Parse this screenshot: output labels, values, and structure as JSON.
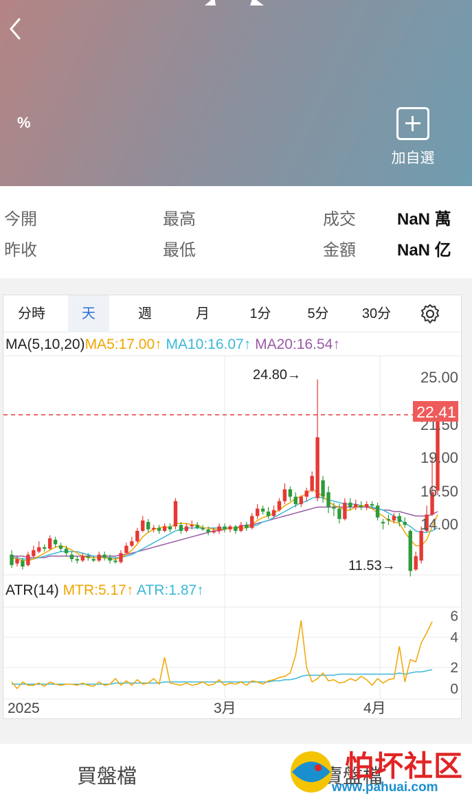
{
  "header": {
    "percent": "%",
    "add_watchlist_label": "加自選"
  },
  "stats": {
    "open_label": "今開",
    "prev_close_label": "昨收",
    "high_label": "最高",
    "low_label": "最低",
    "volume_label": "成交",
    "volume_value": "NaN 萬",
    "amount_label": "金額",
    "amount_value": "NaN 亿"
  },
  "tabs": [
    "分時",
    "天",
    "週",
    "月",
    "1分",
    "5分",
    "30分"
  ],
  "active_tab": "天",
  "indicators": {
    "ma_title": "MA(5,10,20)",
    "ma5": "MA5:17.00↑",
    "ma10": "MA10:16.07↑",
    "ma20": "MA20:16.54↑",
    "atr_title": "ATR(14)",
    "mtr": "MTR:5.17↑",
    "atr": "ATR:1.87↑"
  },
  "colors": {
    "up": "#e53935",
    "down": "#2e9b3a",
    "ma5": "#f0a500",
    "ma10": "#3bb8d8",
    "ma20": "#9b5aa6",
    "accent": "#2b6fd6"
  },
  "chart_data": {
    "type": "candlestick",
    "price_axis_labels": [
      "25.00",
      "21.50",
      "19.00",
      "16.50",
      "14.00"
    ],
    "last_price": "22.41",
    "high_annotation": "24.80→",
    "low_annotation": "11.53→",
    "x_labels": [
      "2025",
      "3月",
      "4月"
    ],
    "atr_axis_labels": [
      "6",
      "4",
      "2",
      "0"
    ],
    "candles": [
      {
        "o": 13.0,
        "c": 12.3,
        "h": 13.3,
        "l": 12.1
      },
      {
        "o": 12.4,
        "c": 12.7,
        "h": 12.9,
        "l": 12.2
      },
      {
        "o": 12.6,
        "c": 12.2,
        "h": 12.8,
        "l": 12.0
      },
      {
        "o": 12.3,
        "c": 13.0,
        "h": 13.2,
        "l": 12.2
      },
      {
        "o": 12.9,
        "c": 13.3,
        "h": 13.6,
        "l": 12.8
      },
      {
        "o": 13.2,
        "c": 13.5,
        "h": 13.9,
        "l": 13.1
      },
      {
        "o": 13.5,
        "c": 13.4,
        "h": 13.7,
        "l": 13.2
      },
      {
        "o": 13.4,
        "c": 14.1,
        "h": 14.3,
        "l": 13.3
      },
      {
        "o": 14.0,
        "c": 13.7,
        "h": 14.2,
        "l": 13.5
      },
      {
        "o": 13.6,
        "c": 13.4,
        "h": 13.8,
        "l": 13.2
      },
      {
        "o": 13.4,
        "c": 13.1,
        "h": 13.6,
        "l": 12.9
      },
      {
        "o": 13.0,
        "c": 12.7,
        "h": 13.2,
        "l": 12.5
      },
      {
        "o": 12.7,
        "c": 12.6,
        "h": 12.9,
        "l": 12.4
      },
      {
        "o": 12.6,
        "c": 12.9,
        "h": 13.1,
        "l": 12.5
      },
      {
        "o": 12.9,
        "c": 12.8,
        "h": 13.1,
        "l": 12.6
      },
      {
        "o": 12.7,
        "c": 12.6,
        "h": 12.9,
        "l": 12.5
      },
      {
        "o": 12.6,
        "c": 13.0,
        "h": 13.2,
        "l": 12.5
      },
      {
        "o": 13.0,
        "c": 12.8,
        "h": 13.2,
        "l": 12.6
      },
      {
        "o": 12.8,
        "c": 12.6,
        "h": 13.0,
        "l": 12.4
      },
      {
        "o": 12.6,
        "c": 12.5,
        "h": 12.8,
        "l": 12.4
      },
      {
        "o": 12.5,
        "c": 13.1,
        "h": 13.3,
        "l": 12.4
      },
      {
        "o": 13.1,
        "c": 13.6,
        "h": 13.8,
        "l": 13.0
      },
      {
        "o": 13.6,
        "c": 13.9,
        "h": 14.2,
        "l": 13.5
      },
      {
        "o": 13.9,
        "c": 14.6,
        "h": 14.8,
        "l": 13.8
      },
      {
        "o": 14.6,
        "c": 15.3,
        "h": 15.6,
        "l": 14.5
      },
      {
        "o": 15.2,
        "c": 14.7,
        "h": 15.4,
        "l": 14.5
      },
      {
        "o": 14.7,
        "c": 14.8,
        "h": 15.0,
        "l": 14.5
      },
      {
        "o": 14.8,
        "c": 14.6,
        "h": 15.0,
        "l": 14.4
      },
      {
        "o": 14.6,
        "c": 14.9,
        "h": 15.1,
        "l": 14.5
      },
      {
        "o": 14.9,
        "c": 14.7,
        "h": 15.1,
        "l": 14.5
      },
      {
        "o": 14.9,
        "c": 16.6,
        "h": 16.8,
        "l": 14.7
      },
      {
        "o": 15.0,
        "c": 14.6,
        "h": 15.2,
        "l": 14.4
      },
      {
        "o": 14.6,
        "c": 14.9,
        "h": 15.1,
        "l": 14.5
      },
      {
        "o": 14.9,
        "c": 15.0,
        "h": 15.3,
        "l": 14.7
      },
      {
        "o": 15.0,
        "c": 14.8,
        "h": 15.2,
        "l": 14.7
      },
      {
        "o": 14.8,
        "c": 14.7,
        "h": 15.0,
        "l": 14.6
      },
      {
        "o": 14.7,
        "c": 14.5,
        "h": 14.9,
        "l": 14.3
      },
      {
        "o": 14.5,
        "c": 14.6,
        "h": 14.8,
        "l": 14.4
      },
      {
        "o": 14.6,
        "c": 14.9,
        "h": 15.1,
        "l": 14.4
      },
      {
        "o": 14.9,
        "c": 14.7,
        "h": 15.1,
        "l": 14.5
      },
      {
        "o": 14.7,
        "c": 14.9,
        "h": 15.0,
        "l": 14.5
      },
      {
        "o": 14.9,
        "c": 14.6,
        "h": 15.0,
        "l": 14.4
      },
      {
        "o": 14.6,
        "c": 15.0,
        "h": 15.2,
        "l": 14.5
      },
      {
        "o": 15.0,
        "c": 14.8,
        "h": 15.2,
        "l": 14.6
      },
      {
        "o": 14.8,
        "c": 15.6,
        "h": 15.8,
        "l": 14.7
      },
      {
        "o": 15.6,
        "c": 16.1,
        "h": 16.4,
        "l": 15.4
      },
      {
        "o": 16.1,
        "c": 15.9,
        "h": 16.3,
        "l": 15.7
      },
      {
        "o": 15.9,
        "c": 15.6,
        "h": 16.2,
        "l": 15.4
      },
      {
        "o": 15.6,
        "c": 16.0,
        "h": 16.3,
        "l": 15.5
      },
      {
        "o": 16.0,
        "c": 16.6,
        "h": 16.8,
        "l": 15.9
      },
      {
        "o": 16.6,
        "c": 17.4,
        "h": 17.8,
        "l": 16.4
      },
      {
        "o": 17.4,
        "c": 16.9,
        "h": 17.6,
        "l": 16.6
      },
      {
        "o": 16.9,
        "c": 16.4,
        "h": 17.2,
        "l": 16.2
      },
      {
        "o": 16.4,
        "c": 16.9,
        "h": 17.0,
        "l": 16.2
      },
      {
        "o": 16.9,
        "c": 17.3,
        "h": 17.5,
        "l": 16.6
      },
      {
        "o": 17.3,
        "c": 18.3,
        "h": 18.6,
        "l": 17.2
      },
      {
        "o": 16.8,
        "c": 20.9,
        "h": 24.8,
        "l": 16.6
      },
      {
        "o": 18.0,
        "c": 16.9,
        "h": 18.3,
        "l": 16.5
      },
      {
        "o": 17.2,
        "c": 16.2,
        "h": 17.6,
        "l": 15.8
      },
      {
        "o": 16.2,
        "c": 16.1,
        "h": 16.5,
        "l": 15.6
      },
      {
        "o": 16.1,
        "c": 15.4,
        "h": 16.4,
        "l": 15.1
      },
      {
        "o": 15.4,
        "c": 16.5,
        "h": 16.8,
        "l": 15.3
      },
      {
        "o": 16.5,
        "c": 16.2,
        "h": 16.8,
        "l": 16.0
      },
      {
        "o": 16.2,
        "c": 16.4,
        "h": 16.7,
        "l": 16.0
      },
      {
        "o": 16.3,
        "c": 16.2,
        "h": 16.6,
        "l": 16.0
      },
      {
        "o": 16.2,
        "c": 16.4,
        "h": 16.6,
        "l": 16.0
      },
      {
        "o": 16.4,
        "c": 16.3,
        "h": 16.6,
        "l": 16.1
      },
      {
        "o": 16.3,
        "c": 15.5,
        "h": 16.5,
        "l": 15.3
      },
      {
        "o": 15.2,
        "c": 15.1,
        "h": 15.4,
        "l": 14.7
      },
      {
        "o": 15.4,
        "c": 15.3,
        "h": 15.7,
        "l": 15.0
      },
      {
        "o": 15.3,
        "c": 15.6,
        "h": 15.8,
        "l": 15.1
      },
      {
        "o": 15.6,
        "c": 15.2,
        "h": 15.8,
        "l": 14.9
      },
      {
        "o": 15.2,
        "c": 15.0,
        "h": 15.5,
        "l": 14.8
      },
      {
        "o": 14.6,
        "c": 11.9,
        "h": 14.7,
        "l": 11.53
      },
      {
        "o": 12.0,
        "c": 12.9,
        "h": 13.2,
        "l": 11.9
      },
      {
        "o": 12.6,
        "c": 14.6,
        "h": 14.9,
        "l": 12.4
      },
      {
        "o": 14.6,
        "c": 15.7,
        "h": 16.3,
        "l": 14.5
      },
      {
        "o": 15.7,
        "c": 17.2,
        "h": 19.6,
        "l": 15.6
      },
      {
        "o": 17.3,
        "c": 22.41,
        "h": 22.5,
        "l": 17.0
      }
    ],
    "ma5": [
      12.8,
      12.7,
      12.6,
      12.6,
      12.7,
      12.9,
      13.1,
      13.3,
      13.5,
      13.6,
      13.5,
      13.3,
      13.1,
      12.9,
      12.8,
      12.8,
      12.8,
      12.8,
      12.7,
      12.7,
      12.8,
      13.0,
      13.3,
      13.7,
      14.2,
      14.5,
      14.7,
      14.8,
      14.9,
      14.8,
      15.1,
      15.1,
      15.1,
      15.0,
      15.0,
      14.8,
      14.8,
      14.7,
      14.7,
      14.7,
      14.8,
      14.8,
      14.8,
      14.8,
      15.0,
      15.3,
      15.5,
      15.6,
      15.8,
      16.0,
      16.3,
      16.5,
      16.8,
      16.9,
      17.1,
      17.4,
      17.2,
      16.9,
      16.6,
      16.3,
      16.2,
      16.0,
      16.0,
      16.2,
      16.3,
      16.3,
      16.1,
      15.8,
      15.6,
      15.3,
      15.2,
      15.1,
      14.5,
      14.0,
      13.6,
      13.6,
      14.0,
      14.9,
      15.7
    ],
    "ma10": [
      12.8,
      12.8,
      12.7,
      12.7,
      12.7,
      12.8,
      12.9,
      13.0,
      13.1,
      13.2,
      13.2,
      13.2,
      13.2,
      13.1,
      13.0,
      12.9,
      12.9,
      12.8,
      12.8,
      12.8,
      12.8,
      12.9,
      13.0,
      13.2,
      13.4,
      13.6,
      13.8,
      14.0,
      14.2,
      14.4,
      14.6,
      14.7,
      14.8,
      14.8,
      14.8,
      14.8,
      14.8,
      14.8,
      14.8,
      14.8,
      14.8,
      14.8,
      14.8,
      14.8,
      14.9,
      15.0,
      15.2,
      15.3,
      15.5,
      15.7,
      15.9,
      16.1,
      16.3,
      16.5,
      16.6,
      16.8,
      16.9,
      16.8,
      16.7,
      16.6,
      16.5,
      16.4,
      16.4,
      16.4,
      16.3,
      16.3,
      16.2,
      16.1,
      16.0,
      15.8,
      15.6,
      15.4,
      15.1,
      14.9,
      14.6,
      14.5,
      14.5,
      14.6,
      14.8
    ],
    "ma20": [
      12.9,
      12.9,
      12.9,
      12.8,
      12.8,
      12.8,
      12.8,
      12.9,
      12.9,
      12.9,
      12.9,
      12.9,
      12.9,
      12.9,
      12.9,
      12.9,
      12.9,
      12.9,
      12.9,
      12.9,
      13.0,
      13.0,
      13.1,
      13.2,
      13.3,
      13.4,
      13.5,
      13.6,
      13.7,
      13.8,
      13.9,
      14.0,
      14.1,
      14.2,
      14.3,
      14.4,
      14.5,
      14.6,
      14.6,
      14.7,
      14.8,
      14.8,
      14.9,
      15.0,
      15.0,
      15.1,
      15.2,
      15.3,
      15.4,
      15.5,
      15.6,
      15.7,
      15.8,
      15.9,
      16.0,
      16.1,
      16.2,
      16.2,
      16.2,
      16.2,
      16.2,
      16.2,
      16.2,
      16.2,
      16.2,
      16.2,
      16.1,
      16.1,
      16.0,
      16.0,
      15.9,
      15.9,
      15.8,
      15.7,
      15.6,
      15.6,
      15.6,
      15.7,
      15.9
    ],
    "mtr": [
      0.8,
      0.2,
      0.8,
      0.5,
      0.5,
      0.7,
      0.4,
      0.8,
      0.6,
      0.5,
      0.6,
      0.6,
      0.5,
      0.7,
      0.5,
      0.4,
      0.8,
      0.5,
      0.6,
      1.1,
      0.5,
      0.9,
      0.5,
      1.0,
      0.6,
      0.7,
      1.1,
      0.6,
      3.0,
      0.7,
      0.6,
      0.5,
      0.7,
      0.5,
      0.6,
      0.8,
      0.5,
      0.6,
      1.0,
      0.5,
      0.7,
      0.6,
      0.8,
      0.5,
      0.9,
      0.8,
      0.6,
      0.9,
      1.0,
      1.2,
      1.3,
      1.6,
      3.2,
      6.3,
      2.1,
      0.8,
      1.1,
      1.6,
      0.9,
      1.0,
      0.7,
      0.8,
      1.1,
      0.9,
      1.3,
      1.0,
      0.5,
      1.1,
      0.7,
      1.0,
      1.1,
      4.0,
      0.8,
      2.8,
      2.6,
      4.3,
      5.2,
      6.2
    ],
    "atr_series": [
      0.6,
      0.6,
      0.6,
      0.6,
      0.6,
      0.6,
      0.6,
      0.6,
      0.6,
      0.6,
      0.6,
      0.6,
      0.6,
      0.6,
      0.6,
      0.6,
      0.6,
      0.6,
      0.6,
      0.7,
      0.7,
      0.7,
      0.7,
      0.7,
      0.7,
      0.7,
      0.7,
      0.7,
      0.8,
      0.8,
      0.8,
      0.8,
      0.8,
      0.8,
      0.8,
      0.8,
      0.8,
      0.8,
      0.8,
      0.8,
      0.8,
      0.8,
      0.8,
      0.8,
      0.8,
      0.8,
      0.8,
      0.8,
      0.9,
      0.9,
      1.0,
      1.0,
      1.1,
      1.3,
      1.4,
      1.4,
      1.4,
      1.4,
      1.4,
      1.4,
      1.5,
      1.5,
      1.5,
      1.5,
      1.5,
      1.5,
      1.5,
      1.5,
      1.5,
      1.5,
      1.5,
      1.6,
      1.5,
      1.6,
      1.7,
      1.7,
      1.8,
      1.9
    ]
  },
  "bottom_tabs": {
    "buy": "買盤檔",
    "sell": "賣盤檔"
  },
  "watermark": {
    "title": "怕坏社区",
    "site": "www.pahuai.com"
  }
}
